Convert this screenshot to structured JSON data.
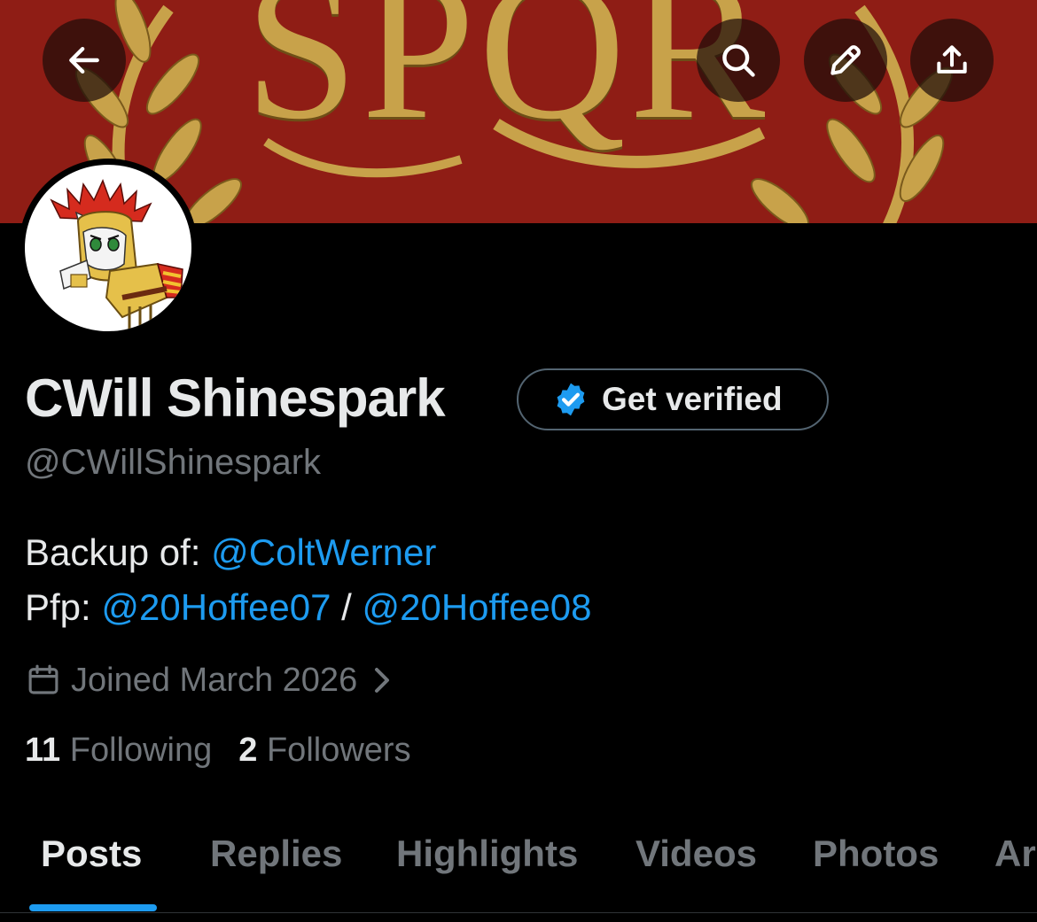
{
  "banner": {
    "text": "SPQR",
    "colors": {
      "background": "#8f1d15",
      "gold": "#c8a24a"
    }
  },
  "header": {
    "buttons": [
      {
        "name": "back",
        "icon": "arrow-left-icon"
      },
      {
        "name": "search",
        "icon": "search-icon"
      },
      {
        "name": "edit",
        "icon": "pencil-icon"
      },
      {
        "name": "share",
        "icon": "share-upload-icon"
      }
    ]
  },
  "profile": {
    "display_name": "CWill Shinespark",
    "verify_label": "Get verified",
    "handle": "@CWillShinespark",
    "bio": {
      "line1_prefix": "Backup of: ",
      "line1_link": "@ColtWerner",
      "line2_prefix": "Pfp: ",
      "line2_link1": "@20Hoffee07",
      "line2_sep": " / ",
      "line2_link2": "@20Hoffee08"
    },
    "joined": "Joined March 2026",
    "following_count": "11",
    "following_label": "Following",
    "followers_count": "2",
    "followers_label": "Followers"
  },
  "tabs": [
    {
      "label": "Posts",
      "active": true
    },
    {
      "label": "Replies",
      "active": false
    },
    {
      "label": "Highlights",
      "active": false
    },
    {
      "label": "Videos",
      "active": false
    },
    {
      "label": "Photos",
      "active": false
    },
    {
      "label": "Ar",
      "active": false
    }
  ],
  "colors": {
    "accent": "#1d9bf0",
    "muted": "#71767b",
    "text": "#e7e9ea",
    "background": "#000000"
  }
}
